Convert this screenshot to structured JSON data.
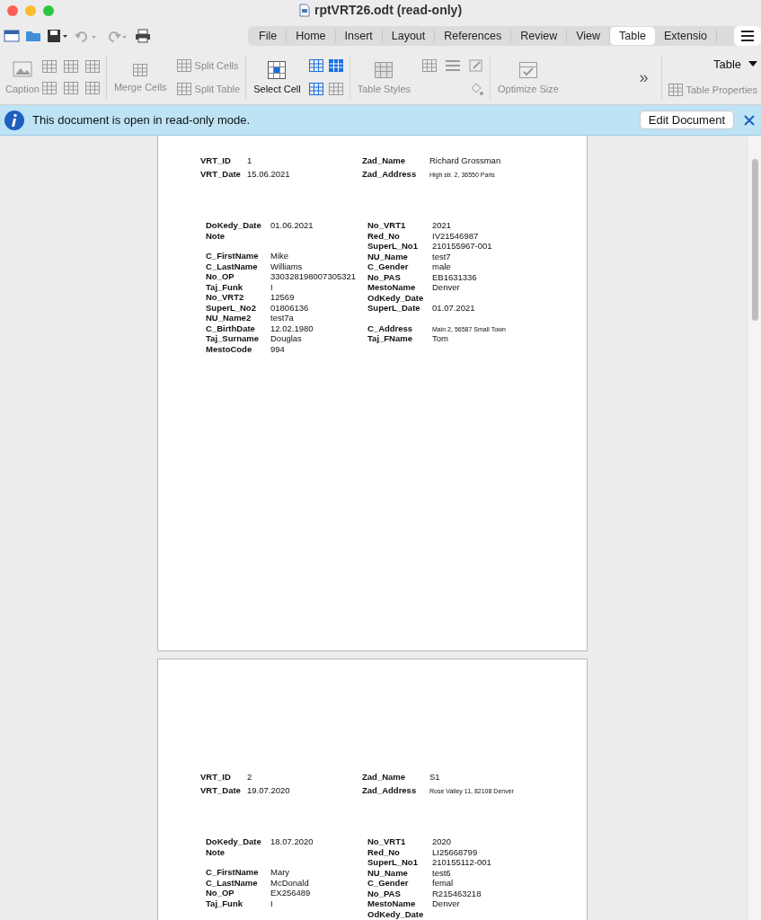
{
  "window": {
    "title": "rptVRT26.odt (read-only)"
  },
  "tabs": [
    {
      "label": "File",
      "selected": false
    },
    {
      "label": "Home",
      "selected": false
    },
    {
      "label": "Insert",
      "selected": false
    },
    {
      "label": "Layout",
      "selected": false
    },
    {
      "label": "References",
      "selected": false
    },
    {
      "label": "Review",
      "selected": false
    },
    {
      "label": "View",
      "selected": false
    },
    {
      "label": "Table",
      "selected": true
    },
    {
      "label": "Extensio",
      "selected": false
    }
  ],
  "ribbon": {
    "caption": {
      "label": "Caption",
      "disabled": true
    },
    "merge_cells": {
      "label": "Merge Cells",
      "disabled": true
    },
    "split_cells": {
      "label": "Split Cells",
      "disabled": true
    },
    "split_table": {
      "label": "Split Table",
      "disabled": true
    },
    "select_cell": {
      "label": "Select Cell",
      "disabled": false
    },
    "table_styles": {
      "label": "Table Styles",
      "disabled": true
    },
    "optimize_size": {
      "label": "Optimize Size",
      "disabled": true
    },
    "more": "»",
    "table_menu": "Table",
    "table_properties": {
      "label": "Table Properties",
      "disabled": true
    }
  },
  "infobar": {
    "message": "This document is open in read-only mode.",
    "button": "Edit Document"
  },
  "pages": [
    {
      "header_left": [
        {
          "label": "VRT_ID",
          "value": "1"
        },
        {
          "label": "VRT_Date",
          "value": "15.06.2021"
        }
      ],
      "header_right": [
        {
          "label": "Zad_Name",
          "value": "Richard Grossman"
        },
        {
          "label": "Zad_Address",
          "value": "High str. 2, 36550 Paris",
          "small": true
        }
      ],
      "left_fields": [
        {
          "label": "DoKedy_Date",
          "value": "01.06.2021"
        },
        {
          "label": "Note"
        },
        {
          "label": "C_FirstName",
          "value": "Mike",
          "gap_before": true
        },
        {
          "label": "C_LastName",
          "value": "Williams"
        },
        {
          "label": "No_OP",
          "value": "330328198007305321"
        },
        {
          "label": "Taj_Funk",
          "value": "I"
        },
        {
          "label": "No_VRT2",
          "value": "12569"
        },
        {
          "label": "SuperL_No2",
          "value": "01806136"
        },
        {
          "label": "NU_Name2",
          "value": "test7a"
        },
        {
          "label": "C_BirthDate",
          "value": "12.02.1980"
        },
        {
          "label": "Taj_Surname",
          "value": "Douglas"
        },
        {
          "label": "MestoCode",
          "value": "994"
        }
      ],
      "right_fields": [
        {
          "label": "No_VRT1",
          "value": "2021"
        },
        {
          "label": "Red_No",
          "value": "IV21546987"
        },
        {
          "label": "SuperL_No1",
          "value": "210155967-001"
        },
        {
          "label": "NU_Name",
          "value": "test7"
        },
        {
          "label": "C_Gender",
          "value": "male"
        },
        {
          "label": "No_PAS",
          "value": "EB1631336"
        },
        {
          "label": "MestoName",
          "value": "Denver"
        },
        {
          "label": "OdKedy_Date"
        },
        {
          "label": "SuperL_Date",
          "value": "01.07.2021"
        },
        {
          "label": "C_Address",
          "value": "Main 2, 56587 Small Town",
          "small": true,
          "gap_before": true
        },
        {
          "label": "Taj_FName",
          "value": "Tom"
        }
      ]
    },
    {
      "header_left": [
        {
          "label": "VRT_ID",
          "value": "2"
        },
        {
          "label": "VRT_Date",
          "value": "19.07.2020"
        }
      ],
      "header_right": [
        {
          "label": "Zad_Name",
          "value": "S1"
        },
        {
          "label": "Zad_Address",
          "value": "Rose Valley 11, 82108 Denver",
          "small": true
        }
      ],
      "left_fields": [
        {
          "label": "DoKedy_Date",
          "value": "18.07.2020"
        },
        {
          "label": "Note"
        },
        {
          "label": "C_FirstName",
          "value": "Mary",
          "gap_before": true
        },
        {
          "label": "C_LastName",
          "value": "McDonald"
        },
        {
          "label": "No_OP",
          "value": "EX256489"
        },
        {
          "label": "Taj_Funk",
          "value": "I"
        }
      ],
      "right_fields": [
        {
          "label": "No_VRT1",
          "value": "2020"
        },
        {
          "label": "Red_No",
          "value": "LI25668799"
        },
        {
          "label": "SuperL_No1",
          "value": "210155112-001"
        },
        {
          "label": "NU_Name",
          "value": "test6"
        },
        {
          "label": "C_Gender",
          "value": "femal"
        },
        {
          "label": "No_PAS",
          "value": "R215463218"
        },
        {
          "label": "MestoName",
          "value": "Denver"
        },
        {
          "label": "OdKedy_Date"
        }
      ]
    }
  ]
}
